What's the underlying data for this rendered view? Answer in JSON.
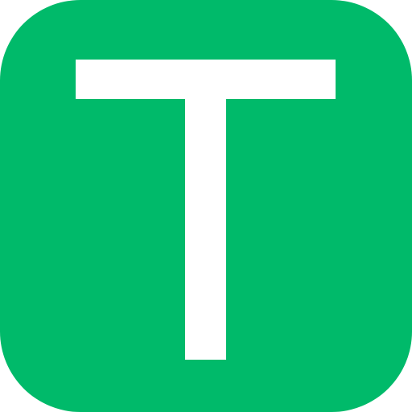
{
  "icon": {
    "name": "letter-t-app-icon",
    "letter": "T",
    "background_color": "#00BA6A",
    "glyph_color": "#FFFFFF"
  }
}
